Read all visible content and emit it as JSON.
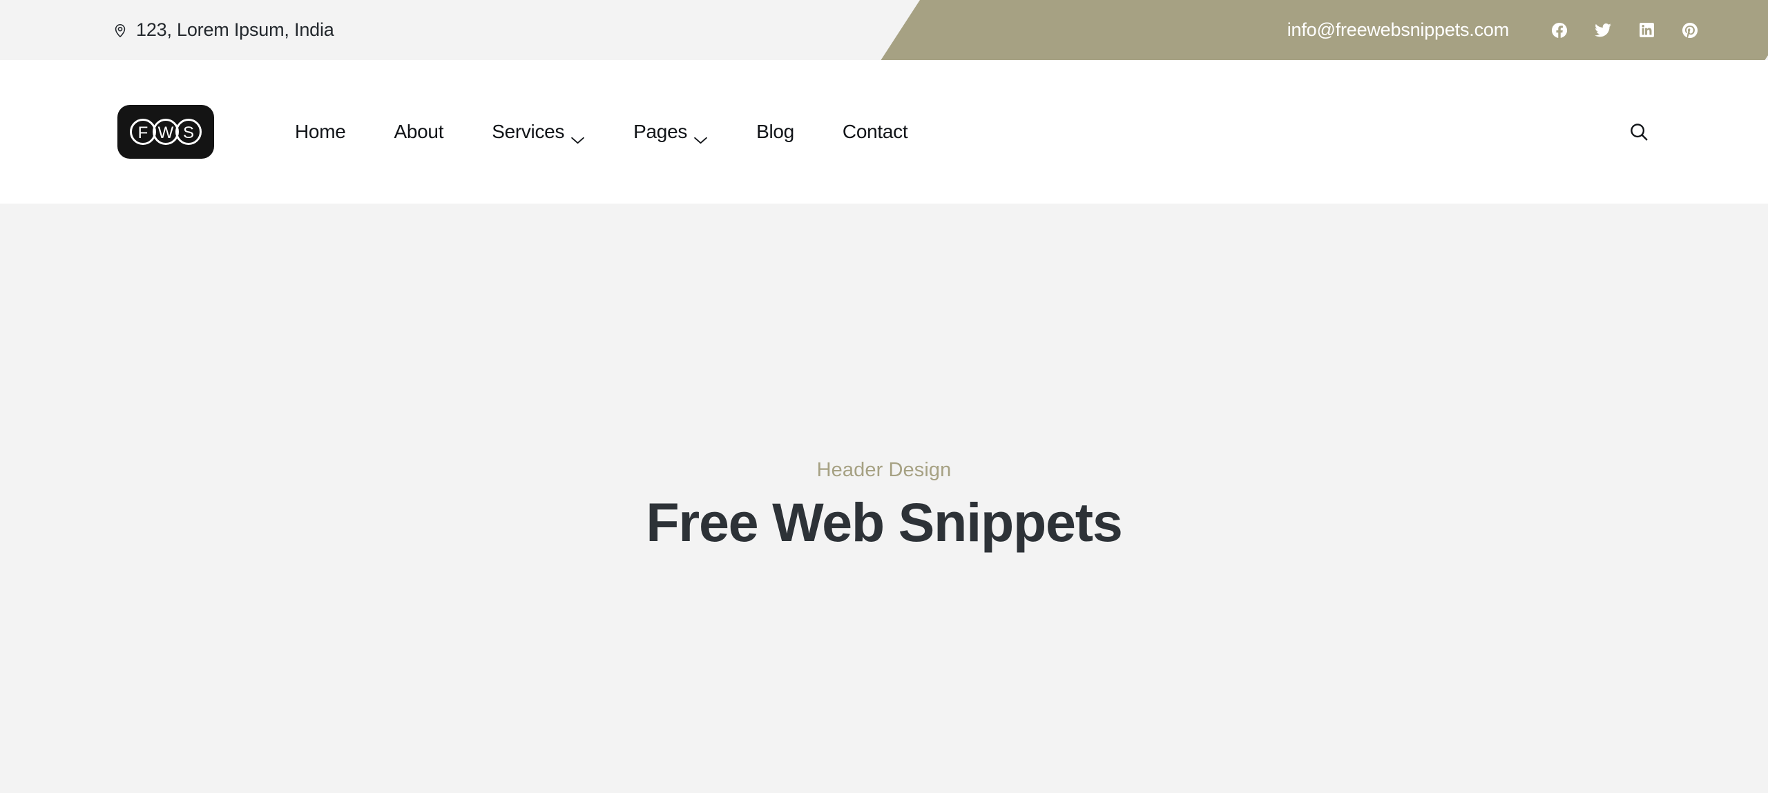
{
  "topbar": {
    "address": "123, Lorem Ipsum, India",
    "address_icon": "location-pin-icon",
    "email": "info@freewebsnippets.com",
    "band_color": "#a6a183",
    "background": "#f3f3f3",
    "socials": [
      {
        "name": "facebook-icon",
        "label": "Facebook"
      },
      {
        "name": "twitter-icon",
        "label": "Twitter"
      },
      {
        "name": "linkedin-icon",
        "label": "LinkedIn"
      },
      {
        "name": "pinterest-icon",
        "label": "Pinterest"
      }
    ]
  },
  "header": {
    "logo": {
      "text": "FWS",
      "letters": [
        "F",
        "W",
        "S"
      ],
      "background": "#141414"
    },
    "nav": [
      {
        "label": "Home",
        "has_dropdown": false
      },
      {
        "label": "About",
        "has_dropdown": false
      },
      {
        "label": "Services",
        "has_dropdown": true
      },
      {
        "label": "Pages",
        "has_dropdown": true
      },
      {
        "label": "Blog",
        "has_dropdown": false
      },
      {
        "label": "Contact",
        "has_dropdown": false
      }
    ],
    "search_icon": "search-icon"
  },
  "hero": {
    "eyebrow": "Header Design",
    "title": "Free Web Snippets",
    "background": "#f3f3f3",
    "eyebrow_color": "#a6a183",
    "title_color": "#2d3237"
  }
}
